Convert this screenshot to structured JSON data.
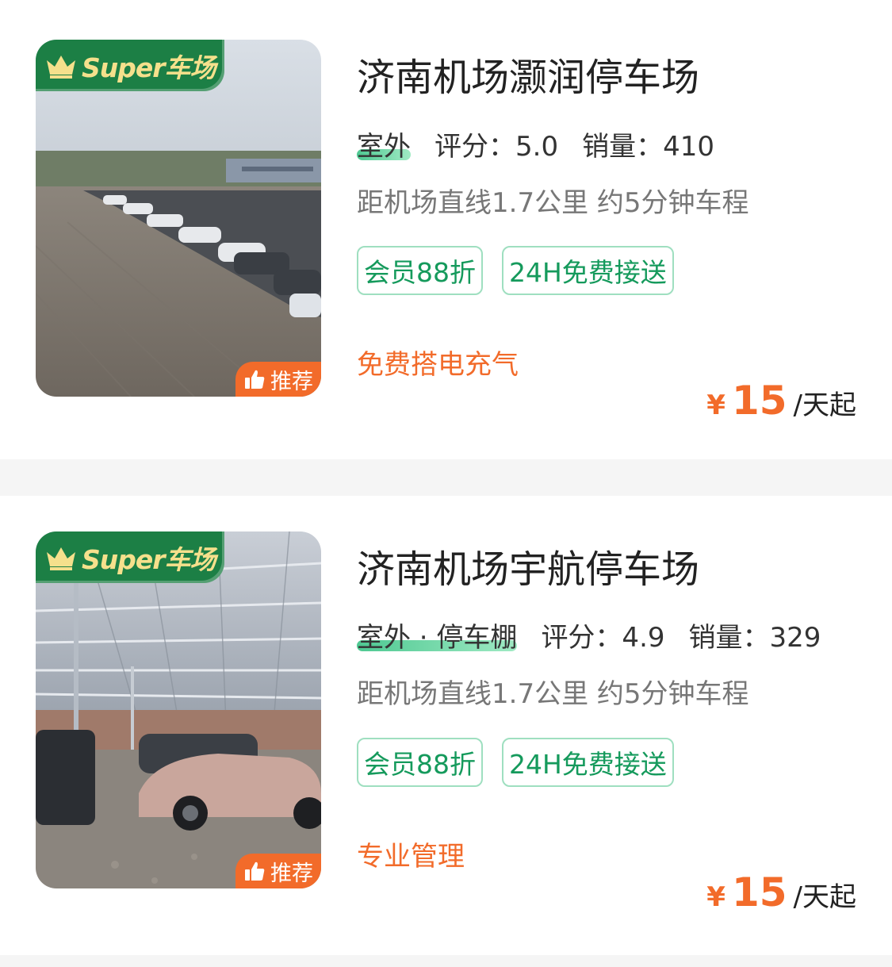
{
  "listings": [
    {
      "badge": "Super车场",
      "recommend": "推荐",
      "name": "济南机场灏润停车场",
      "environment": "室外",
      "rating_label": "评分：5.0",
      "sales_label": "销量：410",
      "distance": "距机场直线1.7公里 约5分钟车程",
      "tags": [
        "会员88折",
        "24H免费接送"
      ],
      "feature": "免费搭电充气",
      "price_symbol": "¥",
      "price": "15",
      "price_unit": "/天起",
      "photo": "outdoor-parking-lot-photo"
    },
    {
      "badge": "Super车场",
      "recommend": "推荐",
      "name": "济南机场宇航停车场",
      "environment": "室外 · 停车棚",
      "rating_label": "评分：4.9",
      "sales_label": "销量：329",
      "distance": "距机场直线1.7公里 约5分钟车程",
      "tags": [
        "会员88折",
        "24H免费接送"
      ],
      "feature": "专业管理",
      "price_symbol": "¥",
      "price": "15",
      "price_unit": "/天起",
      "photo": "covered-parking-shed-photo"
    }
  ],
  "colors": {
    "badge_green": "#1c7f45",
    "badge_text": "#f5e08c",
    "accent_orange": "#f26b2a",
    "tag_green": "#159a5c",
    "tag_border": "#9fdfc0"
  }
}
